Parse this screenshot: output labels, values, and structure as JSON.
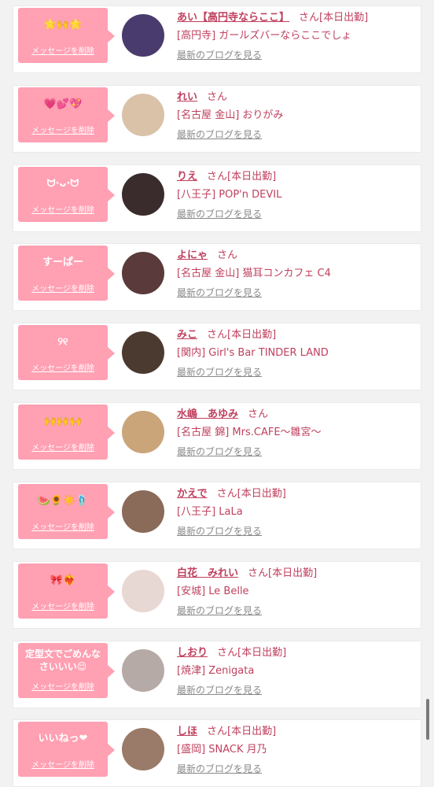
{
  "delete_label": "メッセージを削除",
  "blog_label": "最新のブログを見る",
  "items": [
    {
      "message": "🌟🙌🌟",
      "name": "あい【高円寺ならここ】",
      "suffix": "さん[本日出勤]",
      "shop": "[高円寺] ガールズバーならここでしょ",
      "avatar_color": "#4a3b6e"
    },
    {
      "message": "💗💕💖",
      "name": "れい",
      "suffix": "さん",
      "shop": "[名古屋 金山] おりがみ",
      "avatar_color": "#d9c2a8"
    },
    {
      "message": "ᗢ·ᴗ·ᗢ",
      "name": "りえ",
      "suffix": "さん[本日出勤]",
      "shop": "[八王子] POP'n DEVIL",
      "avatar_color": "#3a2c2c"
    },
    {
      "message": "すーぱー",
      "name": "よにゃ",
      "suffix": "さん",
      "shop": "[名古屋 金山] 猫耳コンカフェ C4",
      "avatar_color": "#5a3a3a"
    },
    {
      "message": "୨୧",
      "name": "みこ",
      "suffix": "さん[本日出勤]",
      "shop": "[関内] Girl's Bar TINDER LAND",
      "avatar_color": "#4b3a30"
    },
    {
      "message": "🙌🙌🙌",
      "name": "水嶋　あゆみ",
      "suffix": "さん",
      "shop": "[名古屋 錦] Mrs.CAFE～雛宮～",
      "avatar_color": "#caa57a"
    },
    {
      "message": "🍉🌻☀️🩴",
      "name": "かえで",
      "suffix": "さん[本日出勤]",
      "shop": "[八王子] LaLa",
      "avatar_color": "#8a6a58"
    },
    {
      "message": "🎀❤️‍🔥",
      "name": "白花　みれい",
      "suffix": "さん[本日出勤]",
      "shop": "[安城] Le Belle",
      "avatar_color": "#e8d8d4"
    },
    {
      "message": "定型文でごめんなさいいい😌",
      "name": "しおり",
      "suffix": "さん[本日出勤]",
      "shop": "[焼津] Zenigata",
      "avatar_color": "#b5aaa6"
    },
    {
      "message": "いいねっ❤︎",
      "name": "しほ",
      "suffix": "さん[本日出勤]",
      "shop": "[盛岡] SNACK 月乃",
      "avatar_color": "#9a7a68"
    }
  ]
}
